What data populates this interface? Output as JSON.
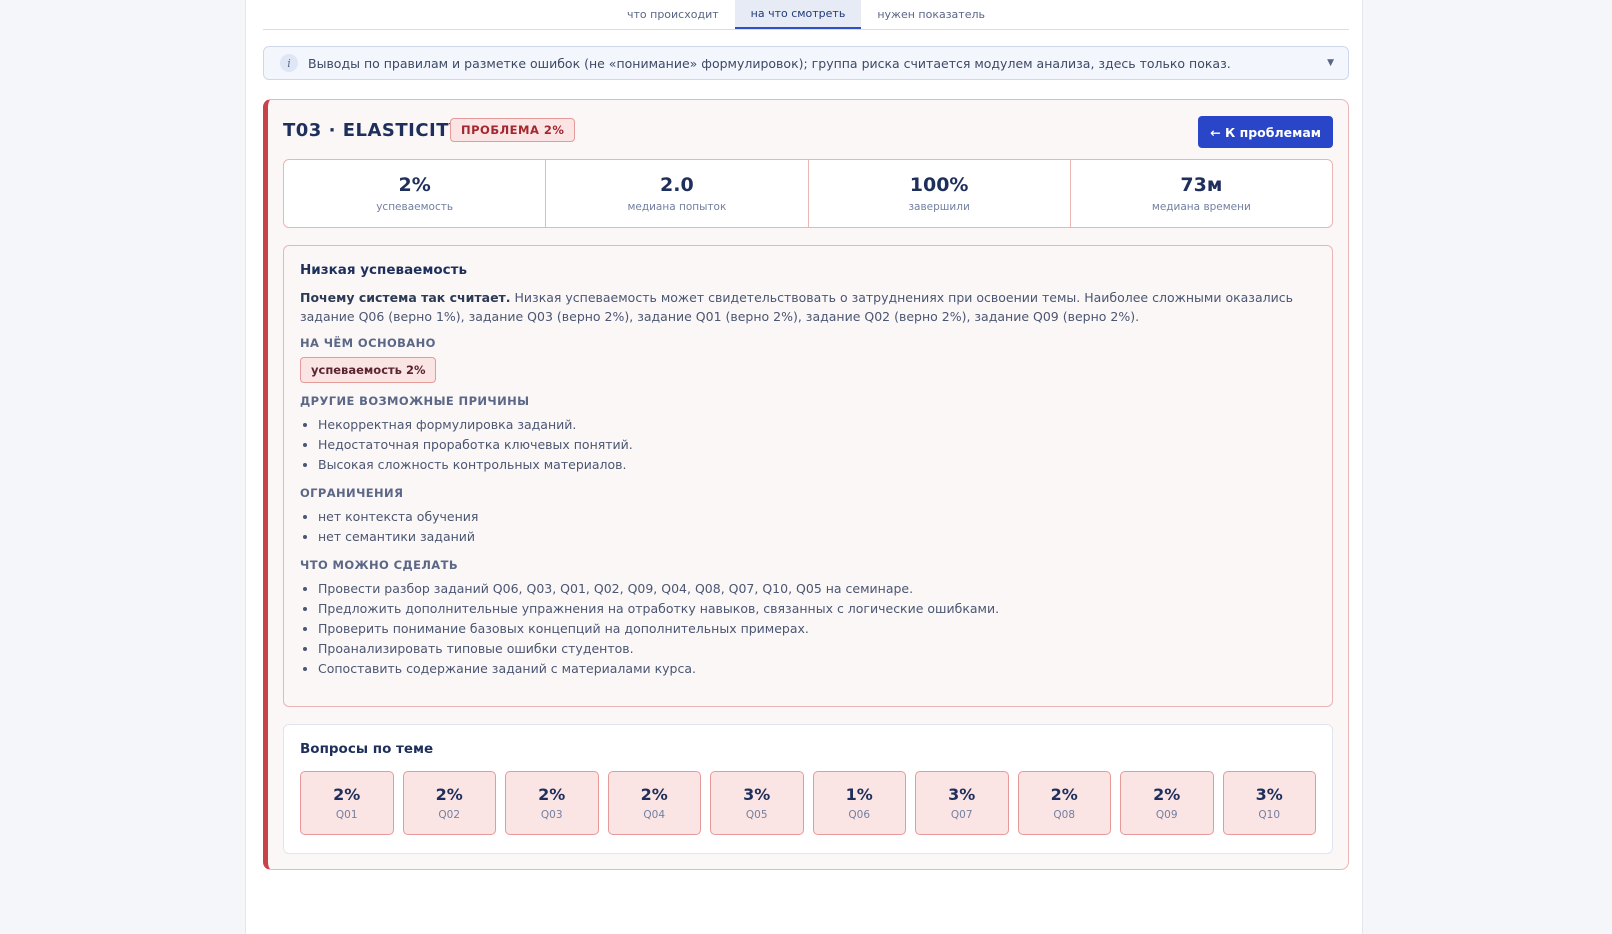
{
  "tabs": [
    {
      "label": "что происходит"
    },
    {
      "label": "на что смотреть"
    },
    {
      "label": "нужен показатель"
    }
  ],
  "info": {
    "icon": "i",
    "text": "Выводы по правилам и разметке ошибок (не «понимание» формулировок); группа риска считается модулем анализа, здесь только показ.",
    "chevron": "▼"
  },
  "card": {
    "title": "T03 · ELASTICITY",
    "badge": "ПРОБЛЕМА 2%",
    "back_label": "← К проблемам",
    "stats": [
      {
        "value": "2%",
        "label": "успеваемость"
      },
      {
        "value": "2.0",
        "label": "медиана попыток"
      },
      {
        "value": "100%",
        "label": "завершили"
      },
      {
        "value": "73м",
        "label": "медиана времени"
      }
    ]
  },
  "reason": {
    "title": "Низкая успеваемость",
    "why_label": "Почему система так считает.",
    "why_text": " Низкая успеваемость может свидетельствовать о затруднениях при освоении темы. Наиболее сложными оказались задание Q06 (верно 1%), задание Q03 (верно 2%), задание Q01 (верно 2%), задание Q02 (верно 2%), задание Q09 (верно 2%).",
    "based_heading": "НА ЧЁМ ОСНОВАНО",
    "based_chip": "успеваемость 2%",
    "other_heading": "ДРУГИЕ ВОЗМОЖНЫЕ ПРИЧИНЫ",
    "other": [
      "Некорректная формулировка заданий.",
      "Недостаточная проработка ключевых понятий.",
      "Высокая сложность контрольных материалов."
    ],
    "limits_heading": "ОГРАНИЧЕНИЯ",
    "limits": [
      "нет контекста обучения",
      "нет семантики заданий"
    ],
    "todo_heading": "ЧТО МОЖНО СДЕЛАТЬ",
    "todo": [
      "Провести разбор заданий Q06, Q03, Q01, Q02, Q09, Q04, Q08, Q07, Q10, Q05 на семинаре.",
      "Предложить дополнительные упражнения на отработку навыков, связанных с логические ошибками.",
      "Проверить понимание базовых концепций на дополнительных примерах.",
      "Проанализировать типовые ошибки студентов.",
      "Сопоставить содержание заданий с материалами курса."
    ]
  },
  "questions": {
    "title": "Вопросы по теме",
    "items": [
      {
        "value": "2%",
        "id": "Q01"
      },
      {
        "value": "2%",
        "id": "Q02"
      },
      {
        "value": "2%",
        "id": "Q03"
      },
      {
        "value": "2%",
        "id": "Q04"
      },
      {
        "value": "3%",
        "id": "Q05"
      },
      {
        "value": "1%",
        "id": "Q06"
      },
      {
        "value": "3%",
        "id": "Q07"
      },
      {
        "value": "2%",
        "id": "Q08"
      },
      {
        "value": "2%",
        "id": "Q09"
      },
      {
        "value": "3%",
        "id": "Q10"
      }
    ]
  },
  "colors": {
    "accent": "#2a46c8",
    "problem": "#c9424a",
    "problem_bg": "#fbe4e4"
  }
}
